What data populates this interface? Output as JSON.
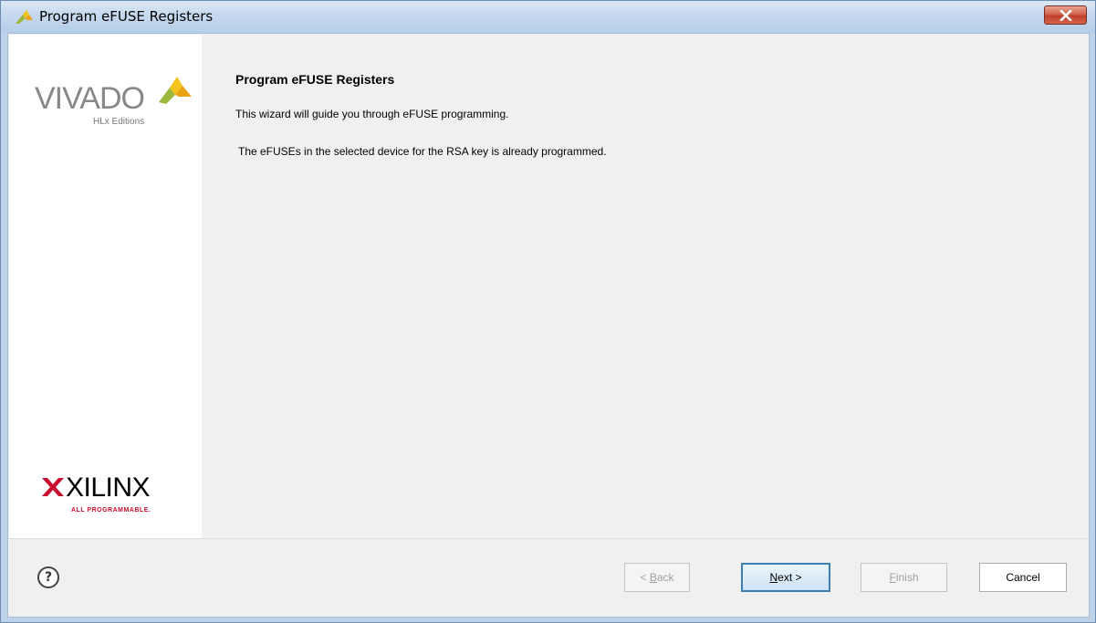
{
  "window": {
    "title": "Program eFUSE Registers"
  },
  "sidebar": {
    "top_logo": {
      "word": "VIVADO",
      "subtitle": "HLx Editions"
    },
    "bottom_logo": {
      "word": "XILINX",
      "subtitle": "ALL PROGRAMMABLE."
    }
  },
  "main": {
    "heading": "Program eFUSE Registers",
    "description": "This wizard will guide you through eFUSE programming.",
    "status_message": "The eFUSEs in the selected device for the RSA key is already programmed."
  },
  "footer": {
    "help_label": "?",
    "back": {
      "prefix": "< ",
      "mnemonic": "B",
      "rest": "ack",
      "enabled": false
    },
    "next": {
      "mnemonic": "N",
      "rest": "ext >",
      "enabled": true
    },
    "finish": {
      "mnemonic": "F",
      "rest": "inish",
      "enabled": false
    },
    "cancel": {
      "label": "Cancel",
      "enabled": true
    }
  },
  "colors": {
    "accent_green": "#9bb83c",
    "accent_yellow": "#f2c41c",
    "xilinx_red": "#c8102e",
    "close_red": "#c1412a"
  }
}
